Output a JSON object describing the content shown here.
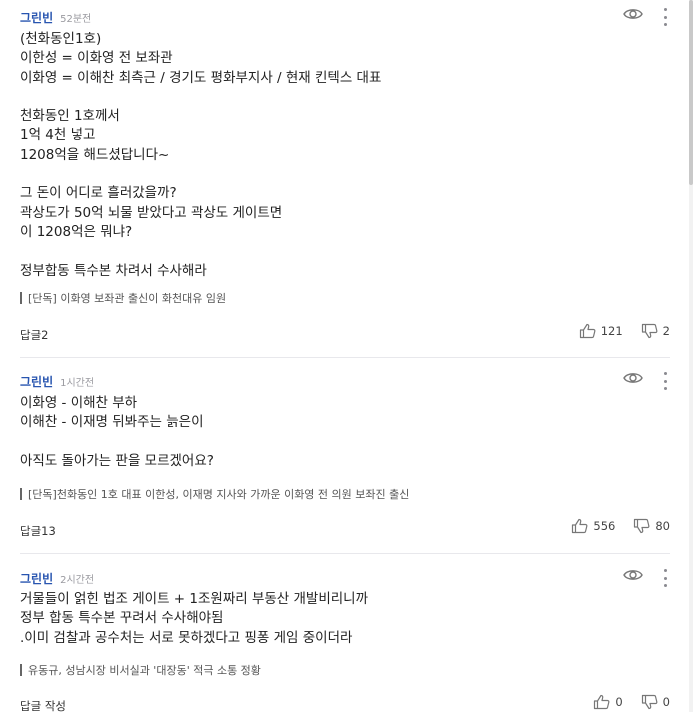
{
  "comments": [
    {
      "author": "그린빈",
      "time": "52분전",
      "lines": [
        "(천화동인1호)",
        "이한성 = 이화영 전 보좌관",
        "이화영 = 이해찬 최측근 / 경기도 평화부지사 / 현재 킨텍스 대표",
        "",
        "천화동인 1호께서",
        "1억 4천 넣고",
        "1208억을 해드셨답니다~",
        "",
        "그 돈이 어디로 흘러갔을까?",
        "곽상도가 50억 뇌물 받았다고 곽상도 게이트면",
        "이 1208억은 뭐냐?",
        "",
        "정부합동 특수본 차려서 수사해라"
      ],
      "link": "[단독] 이화영 보좌관 출신이 화천대유 임원",
      "reply_label": "답글",
      "reply_count": "2",
      "likes": "121",
      "dislikes": "2"
    },
    {
      "author": "그린빈",
      "time": "1시간전",
      "lines": [
        "이화영 - 이해찬 부하",
        "이해찬 - 이재명 뒤봐주는 늙은이",
        "",
        "아직도 돌아가는 판을 모르겠어요?"
      ],
      "link": "[단독]천화동인 1호 대표 이한성, 이재명 지사와 가까운 이화영 전 의원 보좌진 출신",
      "reply_label": "답글",
      "reply_count": "13",
      "likes": "556",
      "dislikes": "80"
    },
    {
      "author": "그린빈",
      "time": "2시간전",
      "lines": [
        "거물들이 얽힌 법조 게이트 + 1조원짜리 부동산 개발비리니까",
        "정부 합동 특수본 꾸려서 수사해야됨",
        ".이미 검찰과 공수처는 서로 못하겠다고 핑퐁 게임 중이더라"
      ],
      "link": "유동규, 성남시장 비서실과 '대장동' 적극 소통 정황",
      "reply_label": "답글 작성",
      "reply_count": "",
      "likes": "0",
      "dislikes": "0"
    }
  ],
  "colors": {
    "author": "#2855b0",
    "text": "#222222",
    "meta": "#9a9aa0"
  },
  "icons": {
    "view": "eye-icon",
    "more": "more-vertical-icon",
    "like": "thumbs-up-icon",
    "dislike": "thumbs-down-icon"
  }
}
